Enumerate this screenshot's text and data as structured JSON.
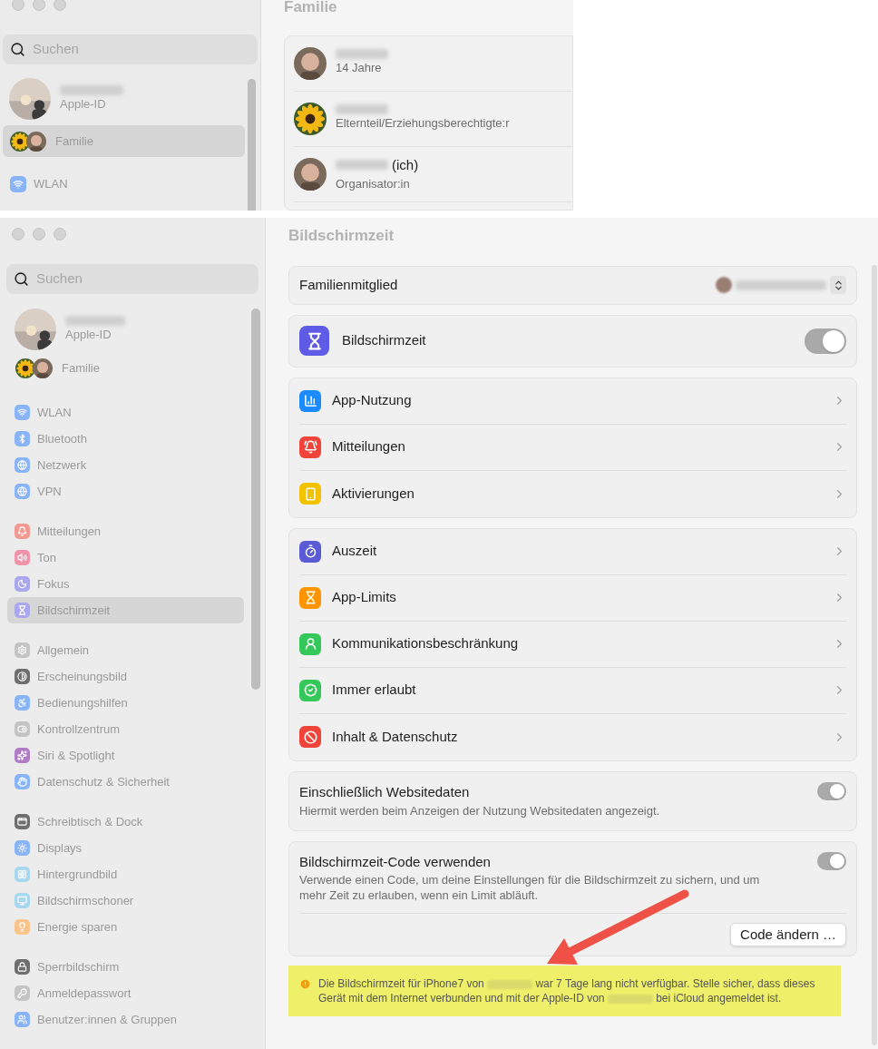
{
  "top_window": {
    "sidebar": {
      "search": {
        "placeholder": "Suchen"
      },
      "account": {
        "subtitle": "Apple-ID"
      },
      "items": [
        {
          "kind": "family",
          "label": "Familie",
          "selected": true
        },
        {
          "kind": "setting",
          "label": "WLAN",
          "selected": false,
          "color": "#8ab4f8"
        }
      ]
    },
    "title": "Familie",
    "members": [
      {
        "subtitle": "14 Jahre"
      },
      {
        "subtitle": "Elternteil/Erziehungsberechtigte:r"
      },
      {
        "name_suffix": "(ich)",
        "subtitle": "Organisator:in"
      }
    ]
  },
  "window": {
    "sidebar": {
      "search": {
        "placeholder": "Suchen"
      },
      "account": {
        "subtitle": "Apple-ID"
      },
      "family": {
        "label": "Familie"
      },
      "groups": [
        [
          {
            "label": "WLAN",
            "color": "#8ab4f8",
            "selected": false
          },
          {
            "label": "Bluetooth",
            "color": "#8ab4f8",
            "selected": false
          },
          {
            "label": "Netzwerk",
            "color": "#8ab4f8",
            "selected": false
          },
          {
            "label": "VPN",
            "color": "#8ab4f8",
            "selected": false
          }
        ],
        [
          {
            "label": "Mitteilungen",
            "color": "#f29a92",
            "selected": false
          },
          {
            "label": "Ton",
            "color": "#f093a8",
            "selected": false
          },
          {
            "label": "Fokus",
            "color": "#a9a7ee",
            "selected": false
          },
          {
            "label": "Bildschirmzeit",
            "color": "#a9a7ee",
            "selected": true
          }
        ],
        [
          {
            "label": "Allgemein",
            "color": "#c4c4c4",
            "selected": false
          },
          {
            "label": "Erscheinungsbild",
            "color": "#6e6e6e",
            "selected": false
          },
          {
            "label": "Bedienungshilfen",
            "color": "#8ab4f8",
            "selected": false
          },
          {
            "label": "Kontrollzentrum",
            "color": "#c4c4c4",
            "selected": false
          },
          {
            "label": "Siri & Spotlight",
            "color": "#b07cc6",
            "selected": false
          },
          {
            "label": "Datenschutz & Sicherheit",
            "color": "#8ab4f8",
            "selected": false
          }
        ],
        [
          {
            "label": "Schreibtisch & Dock",
            "color": "#6e6e6e",
            "selected": false
          },
          {
            "label": "Displays",
            "color": "#8ab4f8",
            "selected": false
          },
          {
            "label": "Hintergrundbild",
            "color": "#a8d8f0",
            "selected": false
          },
          {
            "label": "Bildschirmschoner",
            "color": "#a8d8f0",
            "selected": false
          },
          {
            "label": "Energie sparen",
            "color": "#f8c48a",
            "selected": false
          }
        ],
        [
          {
            "label": "Sperrbildschirm",
            "color": "#6e6e6e",
            "selected": false
          },
          {
            "label": "Anmeldepasswort",
            "color": "#c4c4c4",
            "selected": false
          },
          {
            "label": "Benutzer:innen & Gruppen",
            "color": "#8ab4f8",
            "selected": false
          }
        ]
      ]
    },
    "title": "Bildschirmzeit",
    "member_picker": {
      "label": "Familienmitglied"
    },
    "screen_time": {
      "label": "Bildschirmzeit",
      "on": true
    },
    "groups": [
      [
        {
          "label": "App-Nutzung",
          "color": "#1a8cff"
        },
        {
          "label": "Mitteilungen",
          "color": "#f0443a"
        },
        {
          "label": "Aktivierungen",
          "color": "#f2c200"
        }
      ],
      [
        {
          "label": "Auszeit",
          "color": "#5b5bd6"
        },
        {
          "label": "App-Limits",
          "color": "#ff9500"
        },
        {
          "label": "Kommunikationsbeschränkung",
          "color": "#34c759"
        },
        {
          "label": "Immer erlaubt",
          "color": "#34c759"
        },
        {
          "label": "Inhalt & Datenschutz",
          "color": "#f0443a"
        }
      ]
    ],
    "website_data": {
      "title": "Einschließlich Websitedaten",
      "description": "Hiermit werden beim Anzeigen der Nutzung Websitedaten angezeigt.",
      "on": true
    },
    "code": {
      "title": "Bildschirmzeit-Code verwenden",
      "description": "Verwende einen Code, um deine Einstellungen für die Bildschirmzeit zu sichern, und um mehr Zeit zu erlauben, wenn ein Limit abläuft.",
      "on": true,
      "button": "Code ändern …"
    },
    "warning": {
      "segments": [
        {
          "kind": "text",
          "text": "Die Bildschirmzeit für iPhone7 von "
        },
        {
          "kind": "blurred"
        },
        {
          "kind": "text",
          "text": " war 7 Tage lang nicht verfügbar. Stelle sicher, dass dieses Gerät mit dem Internet verbunden und mit der Apple-ID von "
        },
        {
          "kind": "blurred"
        },
        {
          "kind": "text",
          "text": " bei iCloud angemeldet ist."
        }
      ]
    }
  }
}
